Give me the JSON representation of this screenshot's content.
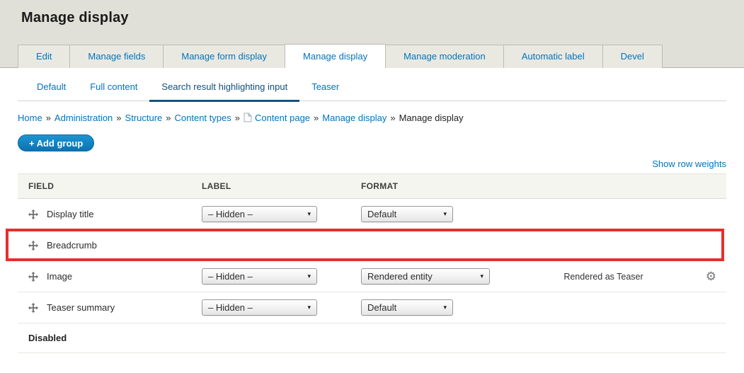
{
  "page": {
    "title": "Manage display"
  },
  "tabs": {
    "items": [
      {
        "label": "Edit",
        "active": false
      },
      {
        "label": "Manage fields",
        "active": false
      },
      {
        "label": "Manage form display",
        "active": false
      },
      {
        "label": "Manage display",
        "active": true
      },
      {
        "label": "Manage moderation",
        "active": false
      },
      {
        "label": "Automatic label",
        "active": false
      },
      {
        "label": "Devel",
        "active": false
      }
    ]
  },
  "subtabs": {
    "items": [
      {
        "label": "Default",
        "active": false
      },
      {
        "label": "Full content",
        "active": false
      },
      {
        "label": "Search result highlighting input",
        "active": true
      },
      {
        "label": "Teaser",
        "active": false
      }
    ]
  },
  "breadcrumb": {
    "separator": "»",
    "items": [
      {
        "label": "Home"
      },
      {
        "label": "Administration"
      },
      {
        "label": "Structure"
      },
      {
        "label": "Content types"
      },
      {
        "label": "Content page",
        "icon": "page-icon"
      },
      {
        "label": "Manage display"
      },
      {
        "label": "Manage display",
        "current": true
      }
    ]
  },
  "actions": {
    "add_group_plus": "+",
    "add_group_label": "Add group"
  },
  "table": {
    "show_row_weights_label": "Show row weights",
    "headers": {
      "field": "FIELD",
      "label": "LABEL",
      "format": "FORMAT"
    },
    "rows": [
      {
        "field": "Display title",
        "label_value": "– Hidden –",
        "format_value": "Default"
      },
      {
        "field": "Breadcrumb",
        "highlighted": true
      },
      {
        "field": "Image",
        "label_value": "– Hidden –",
        "format_value": "Rendered entity",
        "summary": "Rendered as Teaser"
      },
      {
        "field": "Teaser summary",
        "label_value": "– Hidden –",
        "format_value": "Default"
      }
    ],
    "disabled_section_label": "Disabled"
  },
  "icons": {
    "select_arrow": "▾",
    "gear": "⚙"
  },
  "colors": {
    "header_bg": "#e0e0d8",
    "link_blue": "#0074bd",
    "active_subtab_blue": "#14557f",
    "highlight_red": "#e5302c",
    "button_blue": "#0b72b2"
  }
}
